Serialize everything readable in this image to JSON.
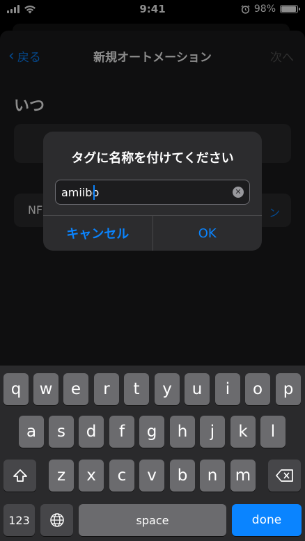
{
  "status_bar": {
    "time": "9:41",
    "battery": "98%",
    "battery_level": 0.98
  },
  "nav": {
    "back_label": "戻る",
    "title": "新規オートメーション",
    "next_label": "次へ"
  },
  "content": {
    "section_title": "いつ",
    "row2_label": "NF",
    "row2_action": "ン"
  },
  "alert": {
    "title": "タグに名称を付けてください",
    "input_value": "amiibo",
    "cancel_label": "キャンセル",
    "ok_label": "OK"
  },
  "keyboard": {
    "row1": [
      "q",
      "w",
      "e",
      "r",
      "t",
      "y",
      "u",
      "i",
      "o",
      "p"
    ],
    "row2": [
      "a",
      "s",
      "d",
      "f",
      "g",
      "h",
      "j",
      "k",
      "l"
    ],
    "row3": [
      "z",
      "x",
      "c",
      "v",
      "b",
      "n",
      "m"
    ],
    "numbers_label": "123",
    "space_label": "space",
    "done_label": "done"
  },
  "colors": {
    "accent": "#0a84ff",
    "background": "#1c1c1e"
  }
}
